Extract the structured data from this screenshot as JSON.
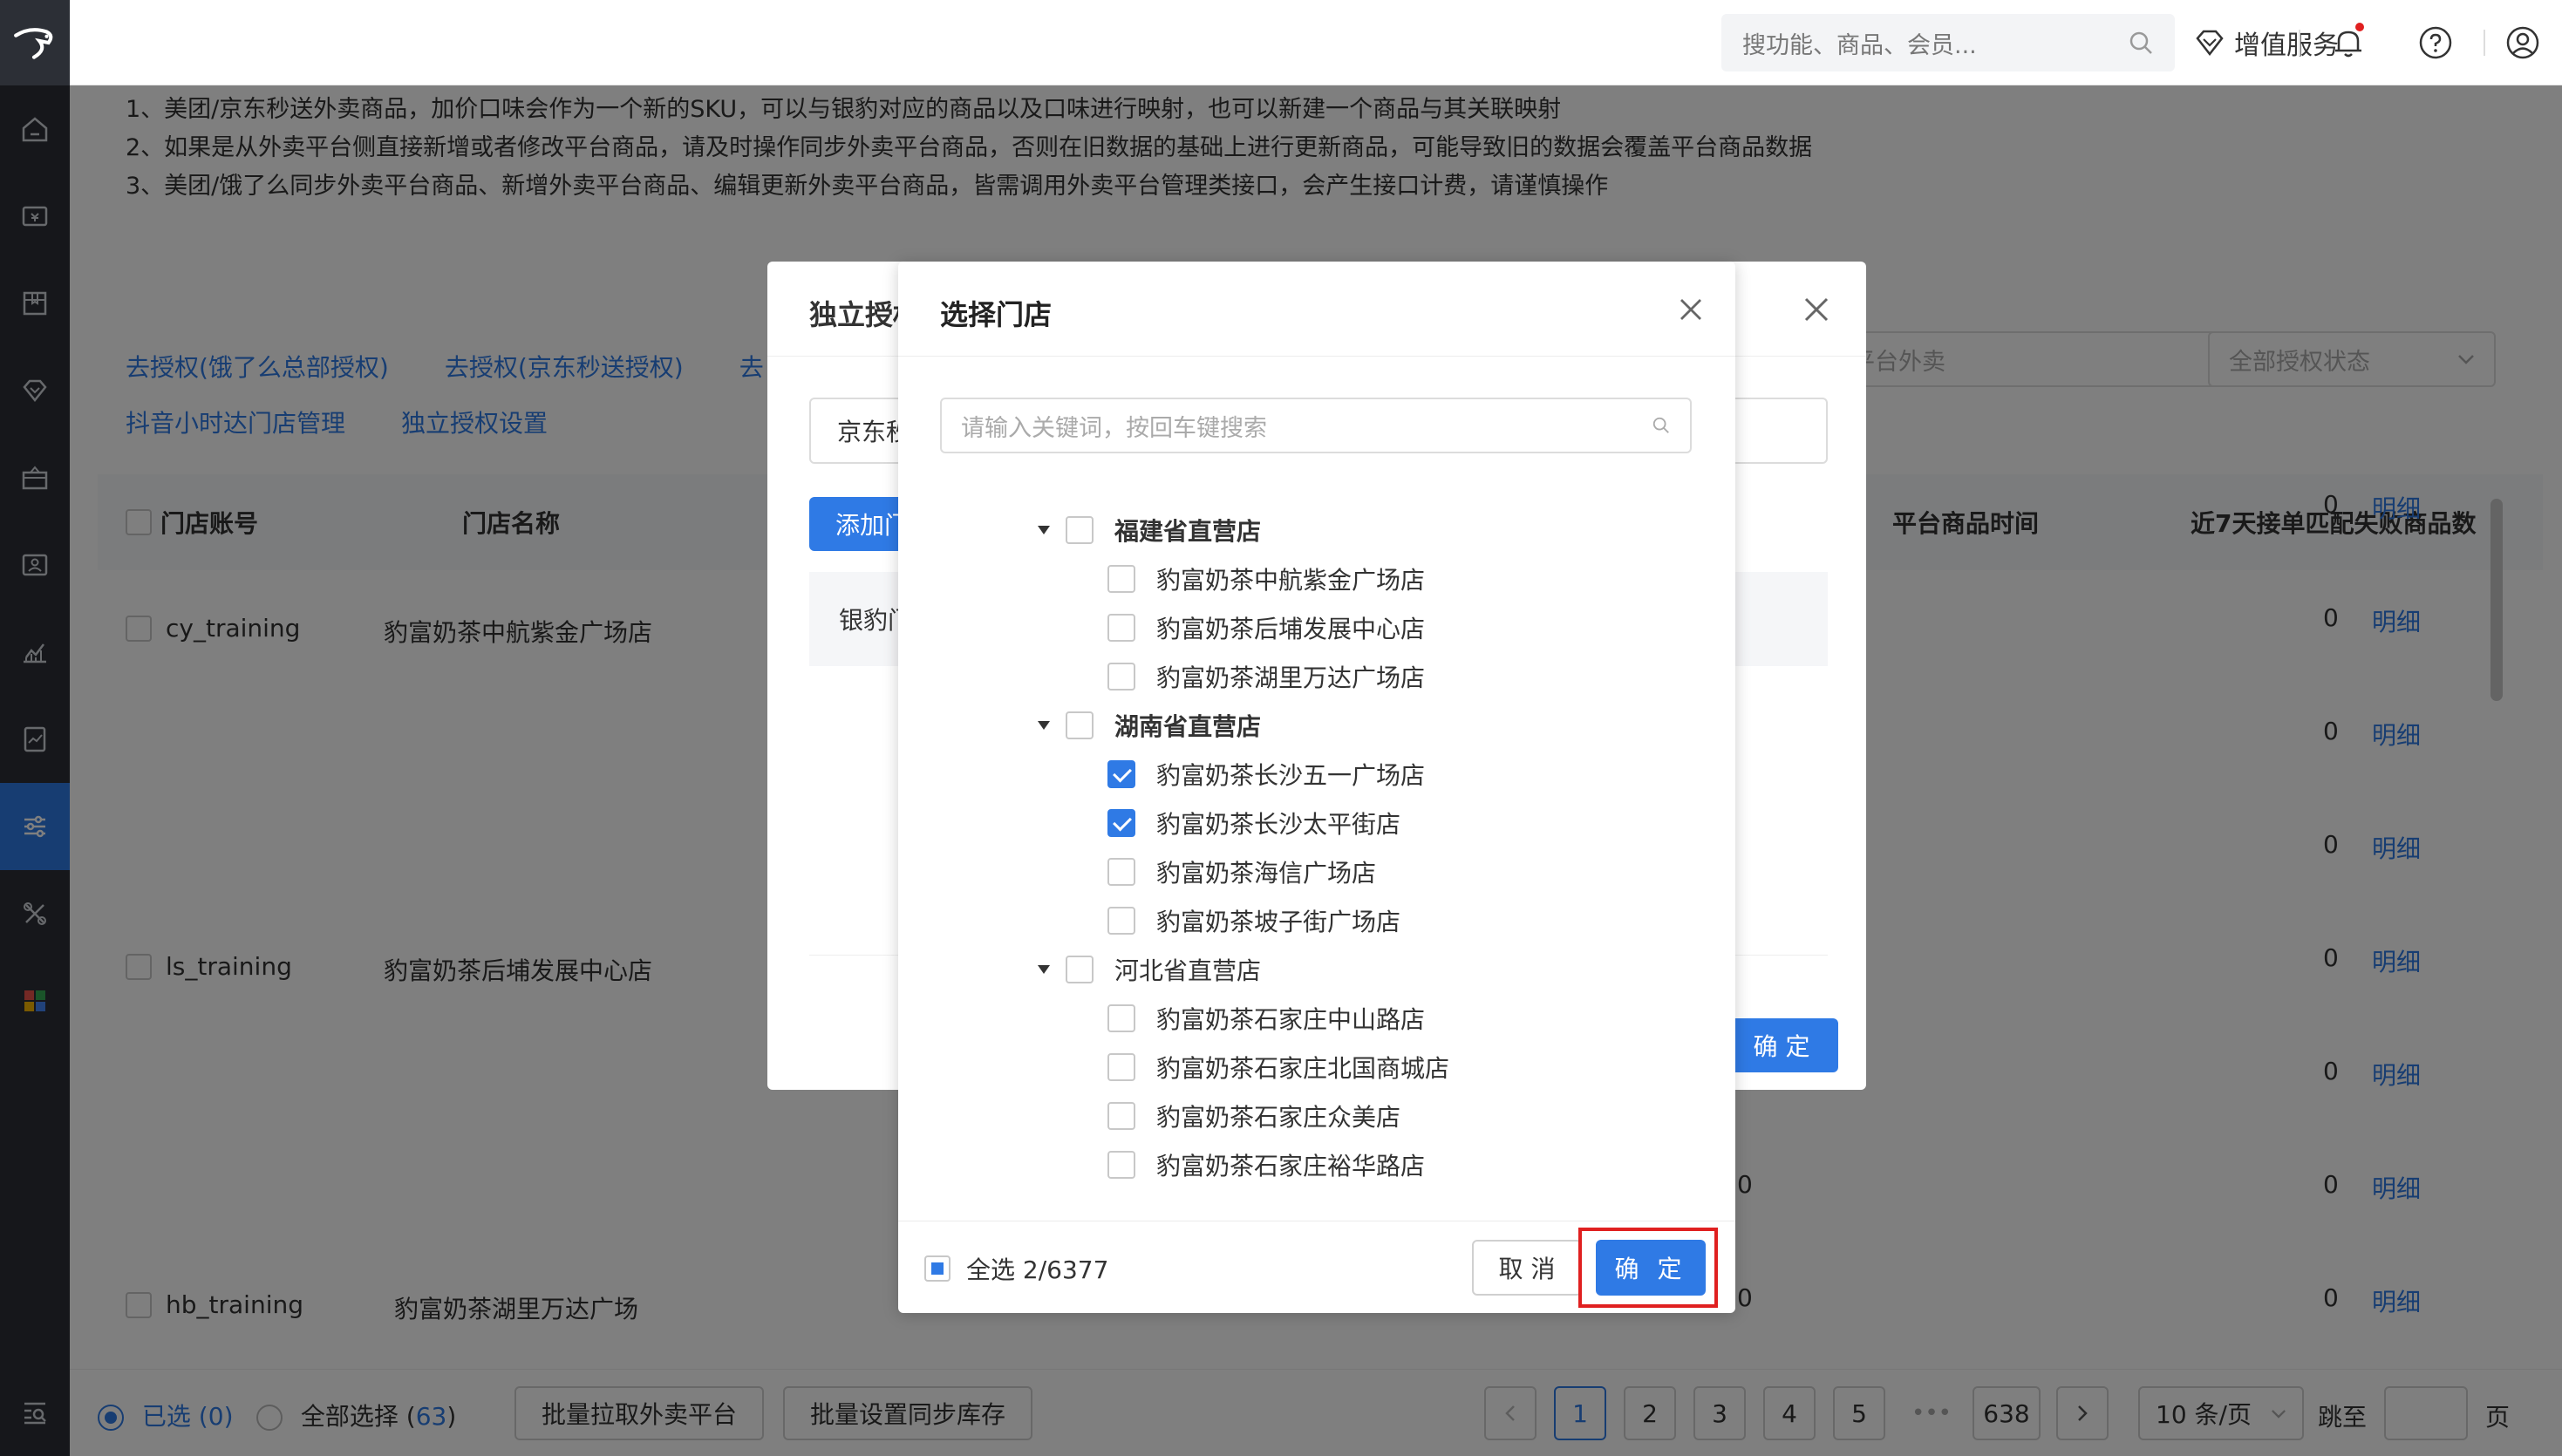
{
  "header": {
    "search_placeholder": "搜功能、商品、会员...",
    "value_added": "增值服务"
  },
  "notice": {
    "line1": "1、美团/京东秒送外卖商品，加价口味会作为一个新的SKU，可以与银豹对应的商品以及口味进行映射，也可以新建一个商品与其关联映射",
    "line2": "2、如果是从外卖平台侧直接新增或者修改平台商品，请及时操作同步外卖平台商品，否则在旧数据的基础上进行更新商品，可能导致旧的数据会覆盖平台商品数据",
    "line3": "3、美团/饿了么同步外卖平台商品、新增外卖平台商品、编辑更新外卖平台商品，皆需调用外卖平台管理类接口，会产生接口计费，请谨慎操作"
  },
  "links": {
    "auth_eleme": "去授权(饿了么总部授权)",
    "auth_jd": "去授权(京东秒送授权)",
    "auth_cut": "去",
    "douyin": "抖音小时达门店管理",
    "independent": "独立授权设置"
  },
  "filters": {
    "platform": "部平台外卖",
    "status": "全部授权状态"
  },
  "table": {
    "col_account": "门店账号",
    "col_name": "门店名称",
    "col_time": "平台商品时间",
    "col_failed": "近7天接单匹配失败商品数",
    "rows": [
      {
        "account": "cy_training",
        "name": "豹富奶茶中航紫金广场店"
      },
      {
        "account": "ls_training",
        "name": "豹富奶茶后埔发展中心店"
      },
      {
        "account": "hb_training",
        "name": "豹富奶茶湖里万达广场"
      }
    ],
    "zero": "0",
    "detail": "明细"
  },
  "bottom": {
    "selected": "已选 (0)",
    "selected_label": "已选 (",
    "selected_count": "0",
    "all_label": "全部选择 (",
    "all_count": "63",
    "close_paren": ")",
    "btn_pull": "批量拉取外卖平台",
    "btn_stock": "批量设置同步库存",
    "pages": [
      "1",
      "2",
      "3",
      "4",
      "5"
    ],
    "ellipsis": "•••",
    "last_page": "638",
    "page_size": "10 条/页",
    "jump": "跳至",
    "page_unit": "页"
  },
  "back_modal": {
    "title": "独立授权",
    "select_value": "京东秒",
    "add_btn": "添加门",
    "gray_text": "银豹门",
    "confirm": "确 定"
  },
  "modal": {
    "title": "选择门店",
    "search_placeholder": "请输入关键词，按回车键搜索",
    "groups": [
      {
        "name": "福建省直营店",
        "stores": [
          {
            "name": "豹富奶茶中航紫金广场店",
            "checked": false
          },
          {
            "name": "豹富奶茶后埔发展中心店",
            "checked": false
          },
          {
            "name": "豹富奶茶湖里万达广场店",
            "checked": false
          }
        ]
      },
      {
        "name": "湖南省直营店",
        "stores": [
          {
            "name": "豹富奶茶长沙五一广场店",
            "checked": true
          },
          {
            "name": "豹富奶茶长沙太平街店",
            "checked": true
          },
          {
            "name": "豹富奶茶海信广场店",
            "checked": false
          },
          {
            "name": "豹富奶茶坡子街广场店",
            "checked": false
          }
        ]
      },
      {
        "name": "河北省直营店",
        "stores": [
          {
            "name": "豹富奶茶石家庄中山路店",
            "checked": false
          },
          {
            "name": "豹富奶茶石家庄北国商城店",
            "checked": false
          },
          {
            "name": "豹富奶茶石家庄众美店",
            "checked": false
          },
          {
            "name": "豹富奶茶石家庄裕华路店",
            "checked": false
          }
        ]
      }
    ],
    "select_all": "全选 2/6377",
    "cancel": "取 消",
    "ok": "确 定"
  },
  "colors": {
    "primary": "#2f7ae5",
    "sidebar": "#2c2f36",
    "highlight": "#e02020"
  }
}
